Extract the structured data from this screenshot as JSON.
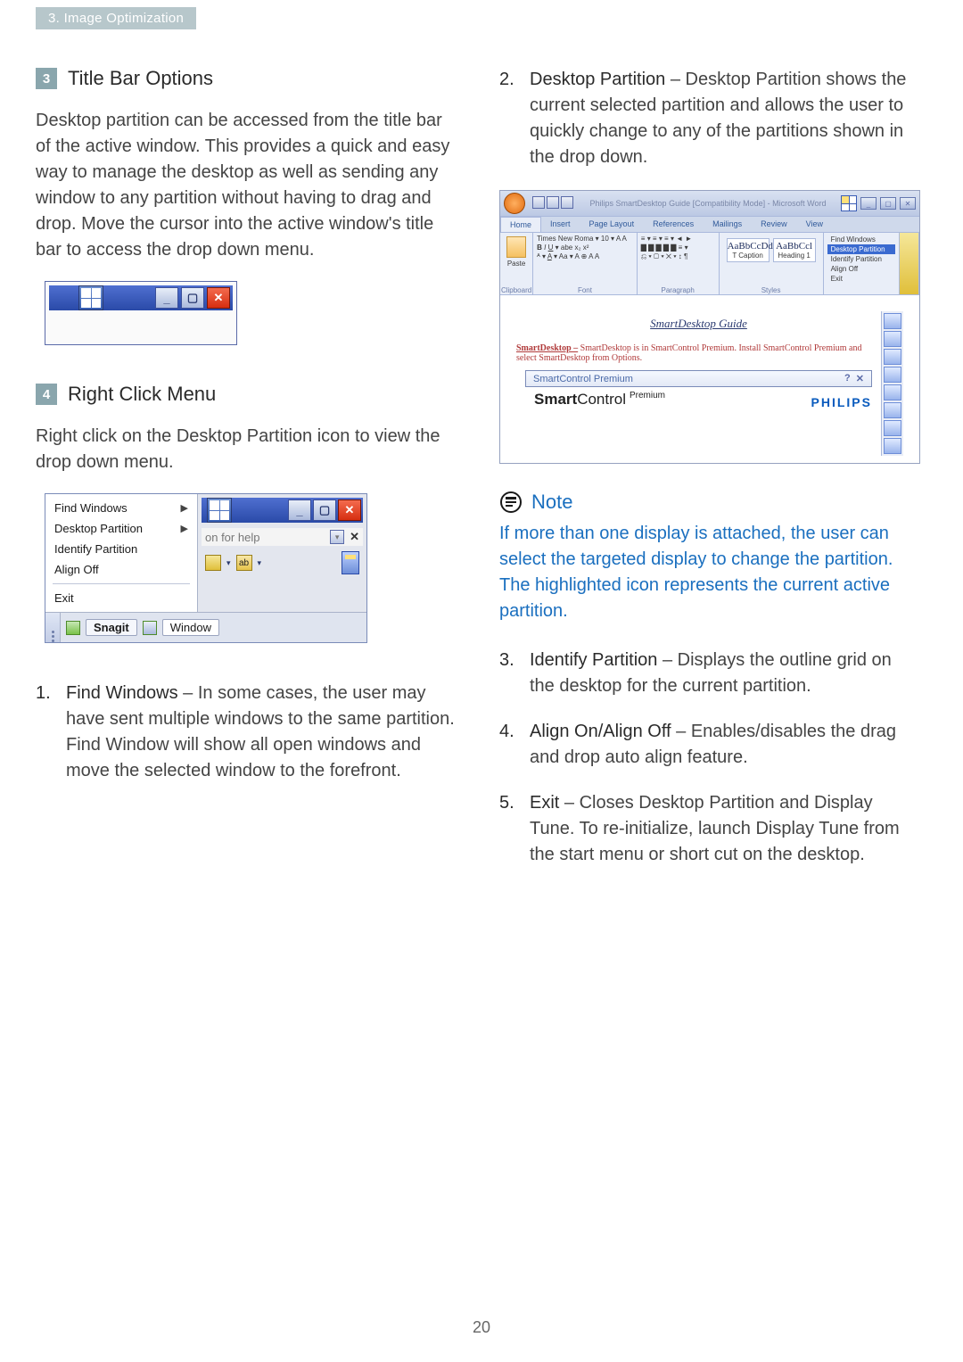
{
  "header": {
    "section": "3. Image Optimization"
  },
  "page_number": "20",
  "colA": {
    "sec3": {
      "num": "3",
      "title": "Title Bar Options"
    },
    "sec3_body": "Desktop partition can be accessed from the title bar of the active window.  This provides a quick and easy way to manage the desktop as well as sending any window to any partition without having to drag and drop.   Move the cursor into the active window's title bar to access the drop down menu.",
    "sec4": {
      "num": "4",
      "title": "Right Click Menu"
    },
    "sec4_body": "Right click on the Desktop Partition icon to view the drop down menu.",
    "ctx_menu": {
      "find": "Find Windows",
      "dp": "Desktop Partition",
      "ident": "Identify Partition",
      "align": "Align Off",
      "exit": "Exit",
      "hint": "on for help",
      "tab1": "Snagit",
      "tab2": "Window",
      "ab": "ab"
    },
    "list1": {
      "num": "1.",
      "title": "Find Windows",
      "body": " – In some cases, the user may have sent multiple windows to the same partition.  Find Window will show all open windows and move the selected window to the forefront."
    }
  },
  "colB": {
    "list2": {
      "num": "2.",
      "title": "Desktop Partition",
      "body": " – Desktop Partition shows the current selected partition and allows the user to quickly change to any of the partitions shown in the drop down."
    },
    "word": {
      "title": "Philips SmartDesktop Guide [Compatibility Mode] - Microsoft Word",
      "tabs": [
        "Home",
        "Insert",
        "Page Layout",
        "References",
        "Mailings",
        "Review",
        "View"
      ],
      "font_label": "Font",
      "para_label": "Paragraph",
      "clip_label": "Clipboard",
      "sty_label": "Styles",
      "paste": "Paste",
      "fontname": "Times New Roma",
      "fontsize": "10",
      "style_sample": "AaBbCcDd",
      "style_sample2": "AaBbCcl",
      "style_cap": "T Caption",
      "style_h1": "Heading 1",
      "dmenu": {
        "find": "Find Windows",
        "dp": "Desktop Partition",
        "ident": "Identify Partition",
        "align": "Align Off",
        "exit": "Exit"
      },
      "doc_title": "SmartDesktop Guide",
      "doc_para_lead": "SmartDesktop –",
      "doc_para_rest": " SmartDesktop is in SmartControl Premium.  Install SmartControl Premium and select SmartDesktop from Options.",
      "dlgbar": "SmartControl Premium",
      "dlgtitle_a": "Smart",
      "dlgtitle_b": "Control",
      "dlgtitle_sup": "Premium",
      "brand": "PHILIPS"
    },
    "note": {
      "title": "Note",
      "body": "If more than one display is attached, the user can select the targeted display to change the partition. The highlighted icon represents the current active partition."
    },
    "list3": {
      "num": "3.",
      "title": "Identify Partition",
      "body": " – Displays the outline grid on the desktop for the current partition."
    },
    "list4": {
      "num": "4.",
      "title": "Align On/Align Off",
      "body": " – Enables/disables the drag and drop auto align feature."
    },
    "list5": {
      "num": "5.",
      "title": "Exit",
      "body": " – Closes Desktop Partition and Display Tune.  To re-initialize, launch Display Tune from the start menu or short cut on the desktop."
    }
  }
}
